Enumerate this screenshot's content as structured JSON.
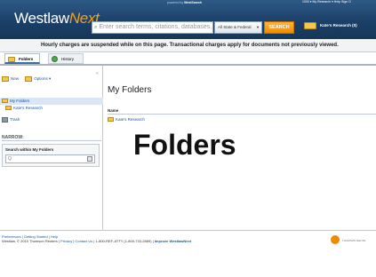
{
  "header": {
    "powered_prefix": "powered by ",
    "powered_brand": "WestSearch",
    "logo_main": "Westlaw",
    "logo_accent": "Next",
    "top_links": "1000 ▾  My Research ▾  Help  Sign O",
    "search_placeholder": "Enter search terms, citations, databases,",
    "jurisdiction": "All State & Federal",
    "search_button": "SEARCH",
    "research_folder": "Kate's Research (0)"
  },
  "notice": "Hourly charges are suspended while on this page. Transactional charges apply for documents not previously viewed.",
  "tabs": [
    {
      "label": "Folders"
    },
    {
      "label": "History"
    }
  ],
  "sidebar": {
    "new_label": "New",
    "options_label": "Options ▾",
    "tree": [
      {
        "label": "My Folders"
      },
      {
        "label": "Kate's Research"
      }
    ],
    "trash_label": "Trash",
    "narrow_heading": "NARROW:",
    "search_within_label": "Search within My Folders",
    "search_within_placeholder": "Q"
  },
  "main": {
    "page_title": "My Folders",
    "column_name": "Name",
    "rows": [
      {
        "name": "Kate's Research"
      }
    ],
    "overlay_title": "Folders"
  },
  "footer": {
    "links_line": "Preferences | Getting Started | Help",
    "copyright": "Westlaw. © 2010 Thomson Reuters | ",
    "privacy": "Privacy",
    "contact": "Contact Us",
    "phone": "1-800-REF-ATTY (1-800-733-2889)",
    "improve": "Improve WestlawNext",
    "brand": "THOMSON REUTE"
  }
}
